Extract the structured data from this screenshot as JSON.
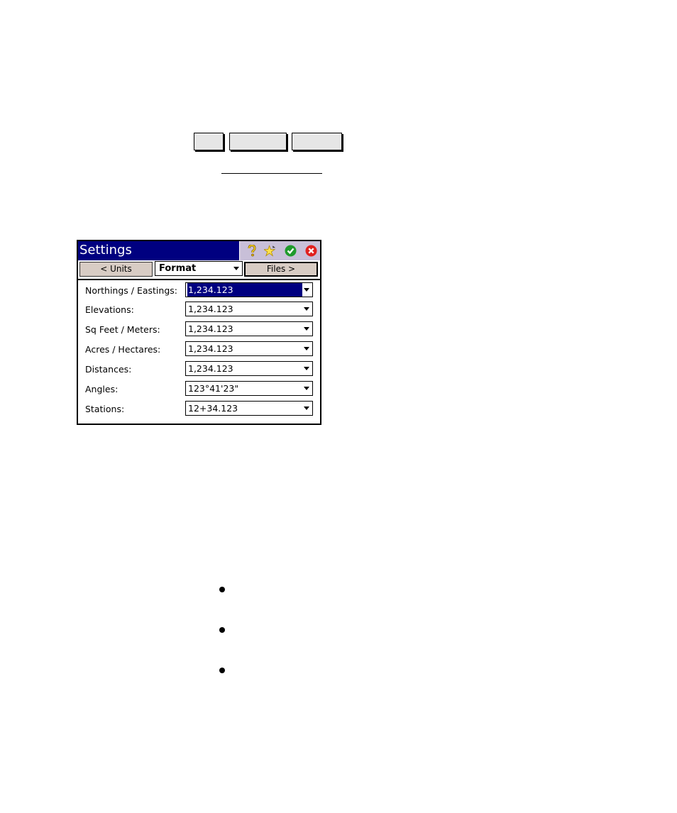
{
  "document": {
    "top_buttons": [
      "",
      "",
      ""
    ],
    "bullets": [
      "",
      "",
      ""
    ]
  },
  "window": {
    "title": "Settings",
    "title_icons": [
      "help-icon",
      "favorite-icon",
      "ok-icon",
      "close-icon"
    ],
    "colors": {
      "titlebar": "#000080",
      "button_face": "#d8ccc4"
    },
    "toolbar": {
      "prev_label": "< Units",
      "page_select": "Format",
      "next_label": "Files >"
    },
    "rows": [
      {
        "label": "Northings / Eastings:",
        "value": "1,234.123",
        "selected": true
      },
      {
        "label": "Elevations:",
        "value": "1,234.123"
      },
      {
        "label": "Sq Feet / Meters:",
        "value": "1,234.123"
      },
      {
        "label": "Acres / Hectares:",
        "value": "1,234.123"
      },
      {
        "label": "Distances:",
        "value": "1,234.123"
      },
      {
        "label": "Angles:",
        "value": "123°41'23\""
      },
      {
        "label": "Stations:",
        "value": "12+34.123"
      }
    ]
  }
}
